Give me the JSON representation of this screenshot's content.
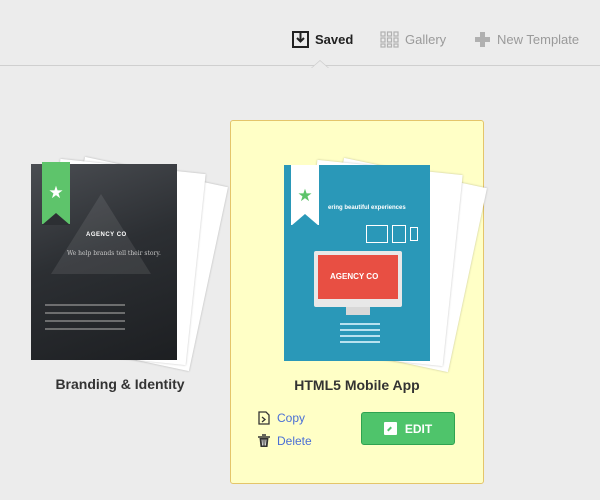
{
  "nav": {
    "saved": "Saved",
    "gallery": "Gallery",
    "new_template": "New Template"
  },
  "templates": [
    {
      "title": "Branding & Identity",
      "cover_brand": "AGENCY CO",
      "cover_tagline": "We help brands tell their story."
    },
    {
      "title": "HTML5 Mobile App",
      "cover_brand": "AGENCY CO",
      "cover_heading": "ering beautiful experiences",
      "actions": {
        "copy": "Copy",
        "delete": "Delete",
        "edit": "EDIT"
      }
    }
  ],
  "colors": {
    "accent_green": "#4fc46b",
    "selected_card_bg": "#ffffc6",
    "link_blue": "#4a6fd6"
  },
  "icons": [
    "saved-icon",
    "gallery-icon",
    "plus-icon",
    "star-icon",
    "copy-icon",
    "trash-icon",
    "edit-icon"
  ]
}
